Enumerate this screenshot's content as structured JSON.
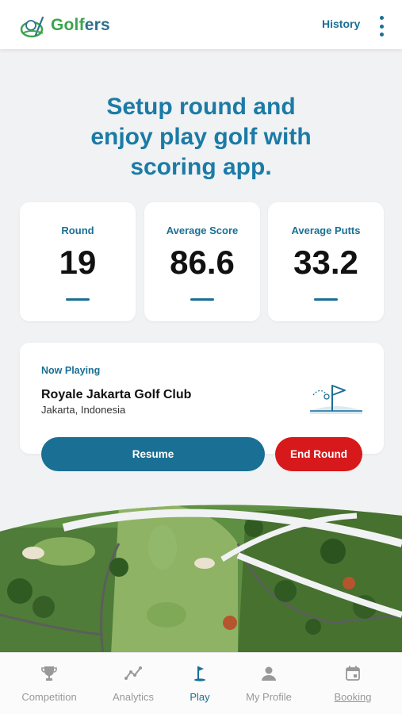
{
  "header": {
    "brand_part1": "Golf",
    "brand_part2": "ers",
    "history_label": "History",
    "logo_icon": "golf-ball-logo-icon",
    "menu_icon": "more-vert-icon"
  },
  "headline": {
    "line1": "Setup round and",
    "line2": "enjoy play golf with",
    "line3": "scoring app."
  },
  "stats": [
    {
      "label": "Round",
      "value": "19"
    },
    {
      "label": "Average Score",
      "value": "86.6"
    },
    {
      "label": "Average Putts",
      "value": "33.2"
    }
  ],
  "now_playing": {
    "label": "Now Playing",
    "club": "Royale Jakarta Golf Club",
    "location": "Jakarta, Indonesia",
    "icon": "golf-flag-icon"
  },
  "actions": {
    "resume_label": "Resume",
    "end_round_label": "End Round"
  },
  "nav": {
    "items": [
      {
        "label": "Competition",
        "icon": "trophy-icon"
      },
      {
        "label": "Analytics",
        "icon": "analytics-icon"
      },
      {
        "label": "Play",
        "icon": "golf-flag-icon"
      },
      {
        "label": "My Profile",
        "icon": "person-icon"
      },
      {
        "label": "Booking",
        "icon": "calendar-icon"
      }
    ],
    "active": "Play"
  },
  "colors": {
    "primary": "#1a6f95",
    "headline": "#1b7ba7",
    "danger": "#d7191c",
    "brand_green": "#3aa54a",
    "background": "#f1f2f3",
    "inactive_nav": "#999999"
  }
}
